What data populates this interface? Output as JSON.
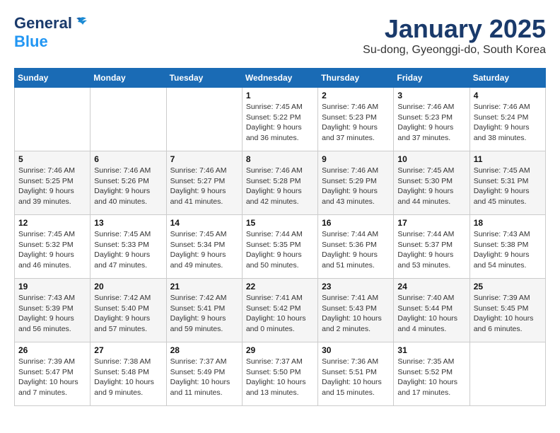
{
  "logo": {
    "general": "General",
    "blue": "Blue"
  },
  "header": {
    "title": "January 2025",
    "subtitle": "Su-dong, Gyeonggi-do, South Korea"
  },
  "weekdays": [
    "Sunday",
    "Monday",
    "Tuesday",
    "Wednesday",
    "Thursday",
    "Friday",
    "Saturday"
  ],
  "weeks": [
    [
      {
        "day": "",
        "info": ""
      },
      {
        "day": "",
        "info": ""
      },
      {
        "day": "",
        "info": ""
      },
      {
        "day": "1",
        "info": "Sunrise: 7:45 AM\nSunset: 5:22 PM\nDaylight: 9 hours and 36 minutes."
      },
      {
        "day": "2",
        "info": "Sunrise: 7:46 AM\nSunset: 5:23 PM\nDaylight: 9 hours and 37 minutes."
      },
      {
        "day": "3",
        "info": "Sunrise: 7:46 AM\nSunset: 5:23 PM\nDaylight: 9 hours and 37 minutes."
      },
      {
        "day": "4",
        "info": "Sunrise: 7:46 AM\nSunset: 5:24 PM\nDaylight: 9 hours and 38 minutes."
      }
    ],
    [
      {
        "day": "5",
        "info": "Sunrise: 7:46 AM\nSunset: 5:25 PM\nDaylight: 9 hours and 39 minutes."
      },
      {
        "day": "6",
        "info": "Sunrise: 7:46 AM\nSunset: 5:26 PM\nDaylight: 9 hours and 40 minutes."
      },
      {
        "day": "7",
        "info": "Sunrise: 7:46 AM\nSunset: 5:27 PM\nDaylight: 9 hours and 41 minutes."
      },
      {
        "day": "8",
        "info": "Sunrise: 7:46 AM\nSunset: 5:28 PM\nDaylight: 9 hours and 42 minutes."
      },
      {
        "day": "9",
        "info": "Sunrise: 7:46 AM\nSunset: 5:29 PM\nDaylight: 9 hours and 43 minutes."
      },
      {
        "day": "10",
        "info": "Sunrise: 7:45 AM\nSunset: 5:30 PM\nDaylight: 9 hours and 44 minutes."
      },
      {
        "day": "11",
        "info": "Sunrise: 7:45 AM\nSunset: 5:31 PM\nDaylight: 9 hours and 45 minutes."
      }
    ],
    [
      {
        "day": "12",
        "info": "Sunrise: 7:45 AM\nSunset: 5:32 PM\nDaylight: 9 hours and 46 minutes."
      },
      {
        "day": "13",
        "info": "Sunrise: 7:45 AM\nSunset: 5:33 PM\nDaylight: 9 hours and 47 minutes."
      },
      {
        "day": "14",
        "info": "Sunrise: 7:45 AM\nSunset: 5:34 PM\nDaylight: 9 hours and 49 minutes."
      },
      {
        "day": "15",
        "info": "Sunrise: 7:44 AM\nSunset: 5:35 PM\nDaylight: 9 hours and 50 minutes."
      },
      {
        "day": "16",
        "info": "Sunrise: 7:44 AM\nSunset: 5:36 PM\nDaylight: 9 hours and 51 minutes."
      },
      {
        "day": "17",
        "info": "Sunrise: 7:44 AM\nSunset: 5:37 PM\nDaylight: 9 hours and 53 minutes."
      },
      {
        "day": "18",
        "info": "Sunrise: 7:43 AM\nSunset: 5:38 PM\nDaylight: 9 hours and 54 minutes."
      }
    ],
    [
      {
        "day": "19",
        "info": "Sunrise: 7:43 AM\nSunset: 5:39 PM\nDaylight: 9 hours and 56 minutes."
      },
      {
        "day": "20",
        "info": "Sunrise: 7:42 AM\nSunset: 5:40 PM\nDaylight: 9 hours and 57 minutes."
      },
      {
        "day": "21",
        "info": "Sunrise: 7:42 AM\nSunset: 5:41 PM\nDaylight: 9 hours and 59 minutes."
      },
      {
        "day": "22",
        "info": "Sunrise: 7:41 AM\nSunset: 5:42 PM\nDaylight: 10 hours and 0 minutes."
      },
      {
        "day": "23",
        "info": "Sunrise: 7:41 AM\nSunset: 5:43 PM\nDaylight: 10 hours and 2 minutes."
      },
      {
        "day": "24",
        "info": "Sunrise: 7:40 AM\nSunset: 5:44 PM\nDaylight: 10 hours and 4 minutes."
      },
      {
        "day": "25",
        "info": "Sunrise: 7:39 AM\nSunset: 5:45 PM\nDaylight: 10 hours and 6 minutes."
      }
    ],
    [
      {
        "day": "26",
        "info": "Sunrise: 7:39 AM\nSunset: 5:47 PM\nDaylight: 10 hours and 7 minutes."
      },
      {
        "day": "27",
        "info": "Sunrise: 7:38 AM\nSunset: 5:48 PM\nDaylight: 10 hours and 9 minutes."
      },
      {
        "day": "28",
        "info": "Sunrise: 7:37 AM\nSunset: 5:49 PM\nDaylight: 10 hours and 11 minutes."
      },
      {
        "day": "29",
        "info": "Sunrise: 7:37 AM\nSunset: 5:50 PM\nDaylight: 10 hours and 13 minutes."
      },
      {
        "day": "30",
        "info": "Sunrise: 7:36 AM\nSunset: 5:51 PM\nDaylight: 10 hours and 15 minutes."
      },
      {
        "day": "31",
        "info": "Sunrise: 7:35 AM\nSunset: 5:52 PM\nDaylight: 10 hours and 17 minutes."
      },
      {
        "day": "",
        "info": ""
      }
    ]
  ]
}
